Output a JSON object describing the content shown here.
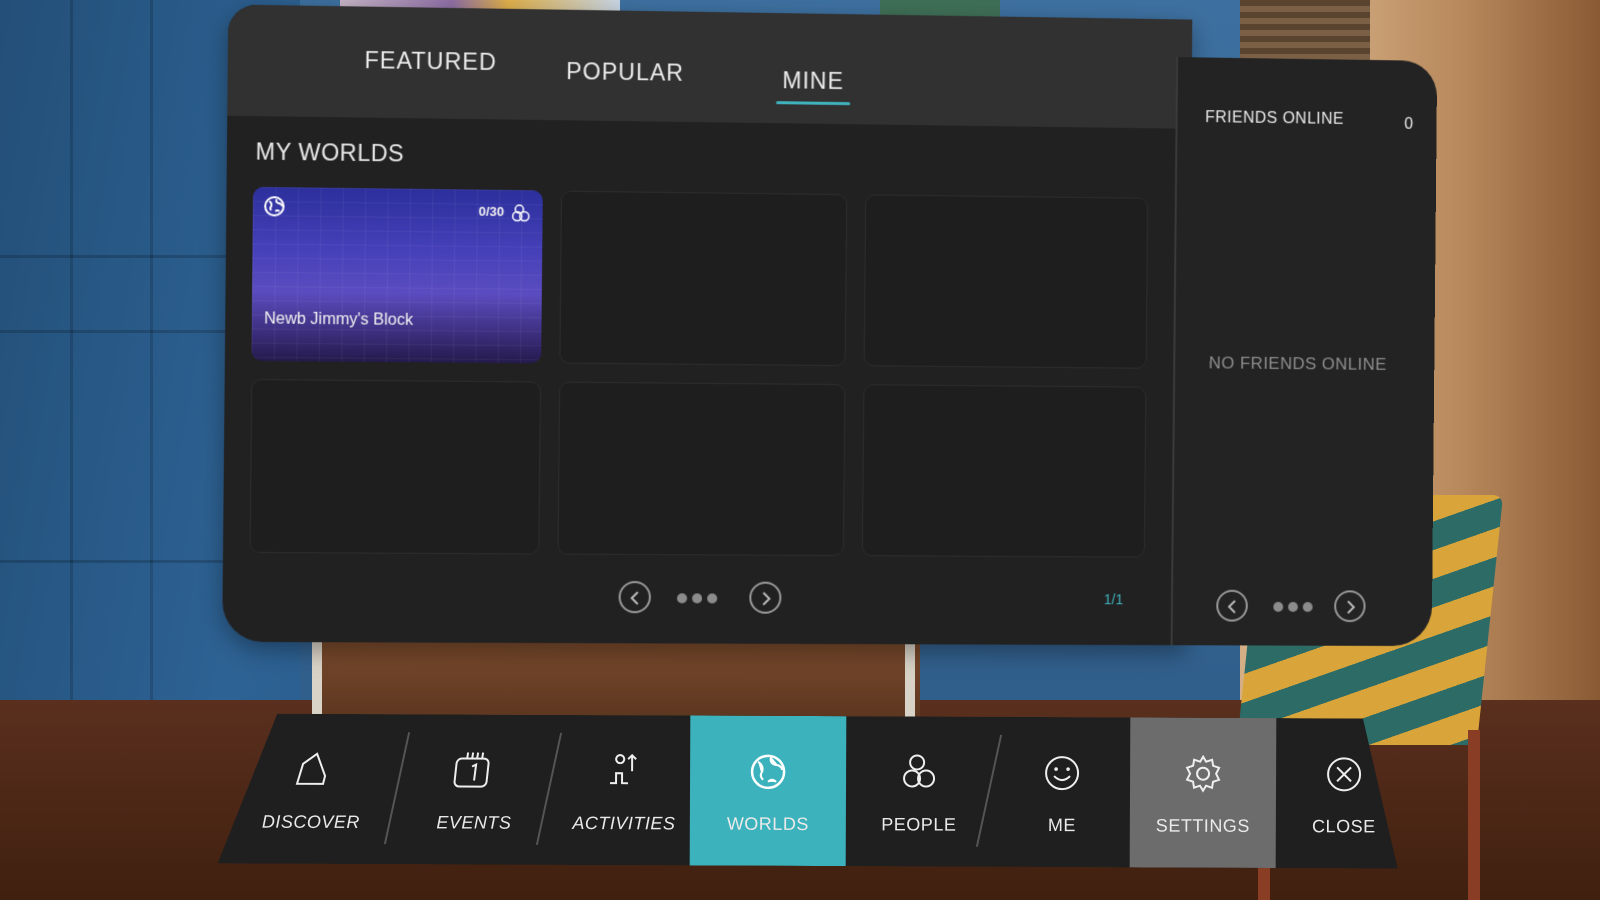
{
  "tabs": [
    {
      "label": "FEATURED",
      "active": false
    },
    {
      "label": "POPULAR",
      "active": false
    },
    {
      "label": "MINE",
      "active": true
    }
  ],
  "section": {
    "title": "MY WORLDS",
    "worlds": [
      {
        "name": "Newb Jimmy's Block",
        "occupancy": "0/30",
        "icon": "globe-icon",
        "occupancy_icon": "people-icon"
      }
    ],
    "empty_slots": 5,
    "page_indicator": "1/1"
  },
  "friends": {
    "title": "FRIENDS ONLINE",
    "count": "0",
    "empty_message": "NO FRIENDS ONLINE"
  },
  "nav": [
    {
      "label": "DISCOVER",
      "icon": "discover-icon",
      "active": false
    },
    {
      "label": "EVENTS",
      "icon": "calendar-icon",
      "active": false
    },
    {
      "label": "ACTIVITIES",
      "icon": "activities-icon",
      "active": false
    },
    {
      "label": "WORLDS",
      "icon": "globe-icon",
      "active": true
    },
    {
      "label": "PEOPLE",
      "icon": "people-icon",
      "active": false
    },
    {
      "label": "ME",
      "icon": "smile-icon",
      "active": false
    },
    {
      "label": "SETTINGS",
      "icon": "gear-icon",
      "active": false
    },
    {
      "label": "CLOSE",
      "icon": "close-icon",
      "active": false
    }
  ],
  "colors": {
    "accent": "#3fb2bd",
    "panel": "#212121",
    "tab_bar": "#313131",
    "settings_bg": "#6c6c6c"
  }
}
